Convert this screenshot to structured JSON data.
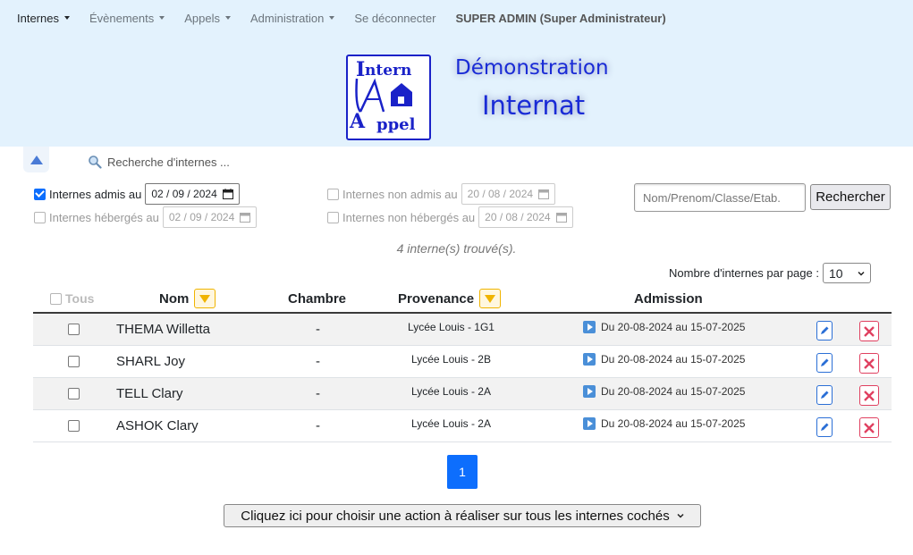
{
  "nav": {
    "items": [
      {
        "label": "Internes",
        "dropdown": true,
        "active": true
      },
      {
        "label": "Évènements",
        "dropdown": true
      },
      {
        "label": "Appels",
        "dropdown": true
      },
      {
        "label": "Administration",
        "dropdown": true
      },
      {
        "label": "Se déconnecter",
        "dropdown": false
      },
      {
        "label": "SUPER ADMIN (Super Administrateur)",
        "dropdown": false
      }
    ]
  },
  "header": {
    "title_line1": "Démonstration",
    "title_line2": "Internat",
    "logo_text": [
      "ntern",
      "ppel"
    ],
    "logo_letters": [
      "I",
      "A"
    ]
  },
  "search": {
    "toggle_label": "Recherche d'internes ...",
    "filters": {
      "admis": {
        "label": "Internes admis au",
        "checked": true,
        "date": "02 / 09 / 2024"
      },
      "heberges": {
        "label": "Internes hébergés au",
        "checked": false,
        "date": "02 / 09 / 2024"
      },
      "non_admis": {
        "label": "Internes non admis au",
        "checked": false,
        "date": "20 / 08 / 2024"
      },
      "non_heberges": {
        "label": "Internes non hébergés au",
        "checked": false,
        "date": "20 / 08 / 2024"
      }
    },
    "input_placeholder": "Nom/Prenom/Classe/Etab.",
    "button_label": "Rechercher"
  },
  "results": {
    "found_text": "4 interne(s) trouvé(s).",
    "per_page_label": "Nombre d'internes par page :",
    "per_page_value": "10"
  },
  "table": {
    "headers": {
      "all": "Tous",
      "nom": "Nom",
      "chambre": "Chambre",
      "provenance": "Provenance",
      "admission": "Admission"
    },
    "rows": [
      {
        "nom": "THEMA Willetta",
        "chambre": "-",
        "provenance": "Lycée Louis - 1G1",
        "admission": "Du 20-08-2024 au 15-07-2025"
      },
      {
        "nom": "SHARL Joy",
        "chambre": "-",
        "provenance": "Lycée Louis - 2B",
        "admission": "Du 20-08-2024 au 15-07-2025"
      },
      {
        "nom": "TELL Clary",
        "chambre": "-",
        "provenance": "Lycée Louis - 2A",
        "admission": "Du 20-08-2024 au 15-07-2025"
      },
      {
        "nom": "ASHOK Clary",
        "chambre": "-",
        "provenance": "Lycée Louis - 2A",
        "admission": "Du 20-08-2024 au 15-07-2025"
      }
    ]
  },
  "pagination": {
    "current": "1"
  },
  "action_select": {
    "label": "Cliquez ici pour choisir une action à réaliser sur tous les internes cochés"
  },
  "colors": {
    "header_bg": "#e3f2fd",
    "title_blue": "#1a2bd6",
    "primary": "#0d6efd",
    "sort_yellow": "#f0b400",
    "delete_red": "#e04060"
  }
}
